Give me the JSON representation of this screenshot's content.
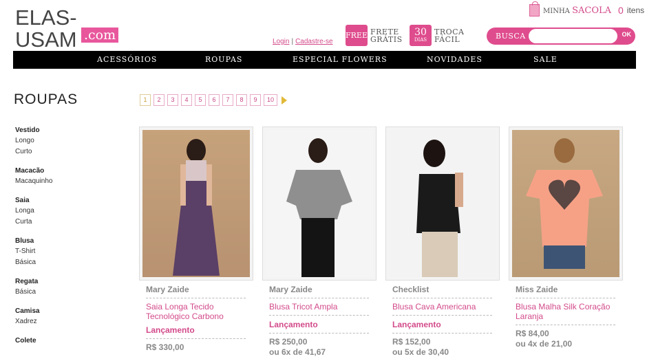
{
  "header": {
    "logo_main": "ELAS-USAM",
    "logo_com": ".com",
    "login": "Login",
    "separator": "|",
    "signup": "Cadastre-se",
    "promo1": {
      "badge": "FREE",
      "line1": "FRETE",
      "line2": "GRÁTIS"
    },
    "promo2": {
      "badge_num": "30",
      "badge_sub": "DIAS",
      "line1": "TROCA",
      "line2": "FÁCIL"
    },
    "bag": {
      "label_small": "MINHA",
      "label": "SACOLA",
      "count": "0",
      "items": "itens"
    },
    "search": {
      "label": "BUSCA",
      "placeholder": "",
      "ok": "OK"
    }
  },
  "nav": {
    "items": [
      "ACESSÓRIOS",
      "ROUPAS",
      "ESPECIAL FLOWERS",
      "NOVIDADES",
      "SALE"
    ]
  },
  "page_title": "ROUPAS",
  "sidebar": [
    {
      "title": "Vestido",
      "subs": [
        "Longo",
        "Curto"
      ]
    },
    {
      "title": "Macacão",
      "subs": [
        "Macaquinho"
      ]
    },
    {
      "title": "Saia",
      "subs": [
        "Longa",
        "Curta"
      ]
    },
    {
      "title": "Blusa",
      "subs": [
        "T-Shirt",
        "Básica"
      ]
    },
    {
      "title": "Regata",
      "subs": [
        "Básica"
      ]
    },
    {
      "title": "Camisa",
      "subs": [
        "Xadrez"
      ]
    },
    {
      "title": "Colete",
      "subs": []
    }
  ],
  "pagination": [
    "1",
    "2",
    "3",
    "4",
    "5",
    "6",
    "7",
    "8",
    "9",
    "10"
  ],
  "products": [
    {
      "brand": "Mary Zaide",
      "name": "Saia Longa Tecido Tecnológico Carbono",
      "tag": "Lançamento",
      "price": "R$ 330,00",
      "installments": ""
    },
    {
      "brand": "Mary Zaide",
      "name": "Blusa Tricot Ampla",
      "tag": "Lançamento",
      "price": "R$ 250,00",
      "installments": "ou 6x de 41,67"
    },
    {
      "brand": "Checklist",
      "name": "Blusa Cava Americana",
      "tag": "Lançamento",
      "price": "R$ 152,00",
      "installments": "ou 5x de 30,40"
    },
    {
      "brand": "Miss Zaide",
      "name": "Blusa Malha Silk Coração Laranja",
      "tag": "",
      "price": "R$ 84,00",
      "installments": "ou 4x de 21,00"
    }
  ],
  "colors": {
    "accent": "#df4c8d",
    "nav_bg": "#000000",
    "page_border": "#e7a9c7"
  }
}
